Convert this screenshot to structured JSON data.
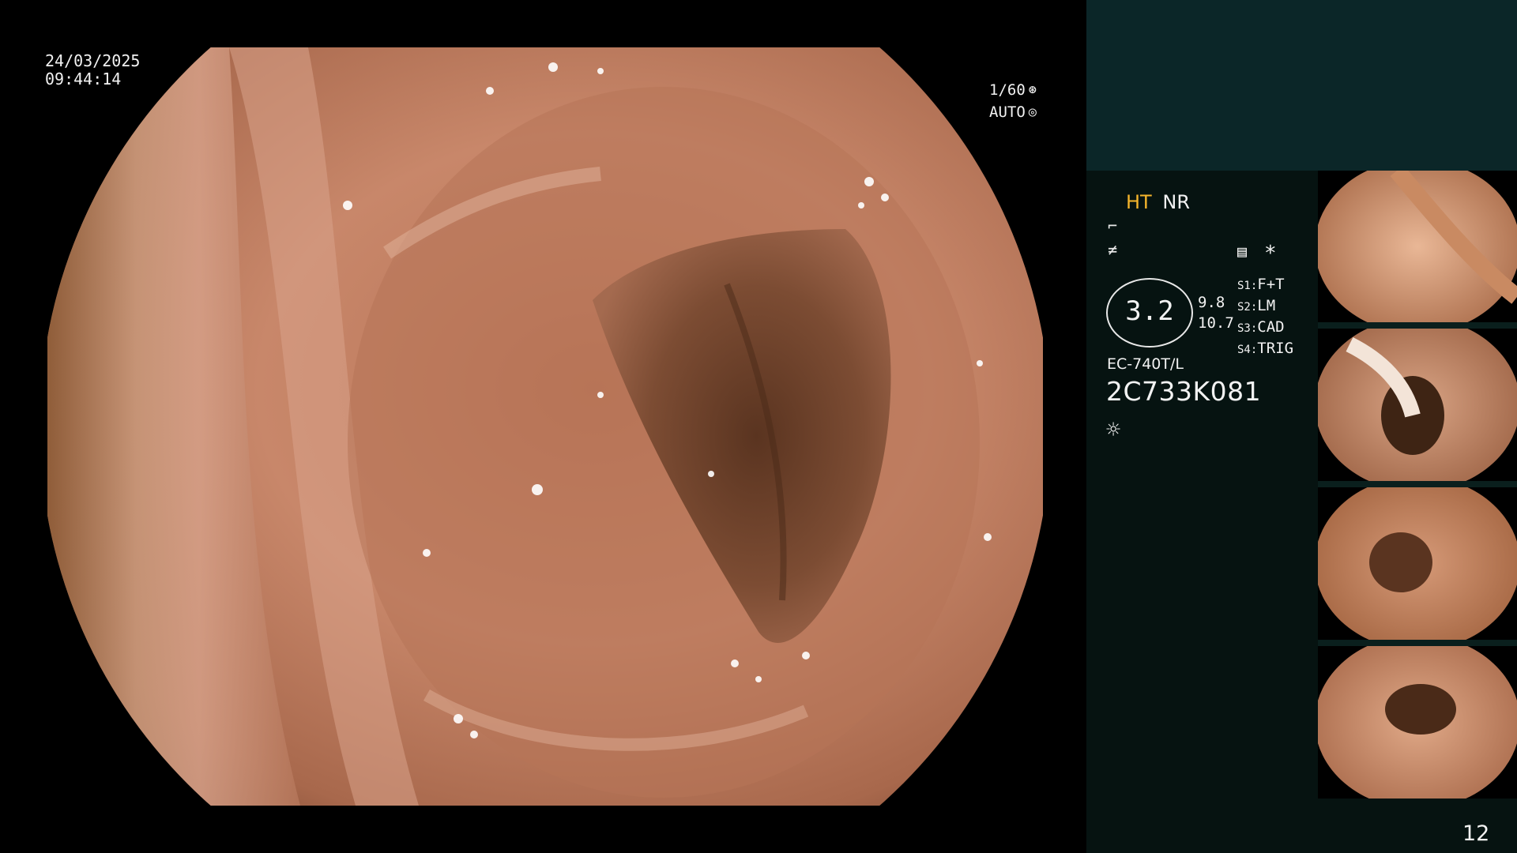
{
  "overlay": {
    "date": "24/03/2025",
    "time": "09:44:14",
    "shutter": "1/60",
    "iris": "AUTO"
  },
  "panel": {
    "mode_ht": "HT",
    "mode_nr": "NR",
    "zoom": "3.2",
    "zoom_sub1": "9.8",
    "zoom_sub2": "10.7",
    "switches": [
      {
        "key": "S1:",
        "value": "F+T"
      },
      {
        "key": "S2:",
        "value": "LM"
      },
      {
        "key": "S3:",
        "value": "CAD"
      },
      {
        "key": "S4:",
        "value": "TRIG"
      }
    ],
    "scope_model": "EC-740T/L",
    "scope_serial": "2C733K081",
    "page_number": "12"
  },
  "icons": {
    "shutter": "aperture-icon",
    "iris": "iris-icon",
    "enhance": "enhance-icon",
    "structure": "structure-icon",
    "menu": "memo-icon",
    "star": "asterisk-icon",
    "light": "light-icon"
  },
  "colors": {
    "accent_ht": "#f5b52c",
    "panel_bg": "#061311",
    "panel_top_bg": "#0b2628"
  }
}
